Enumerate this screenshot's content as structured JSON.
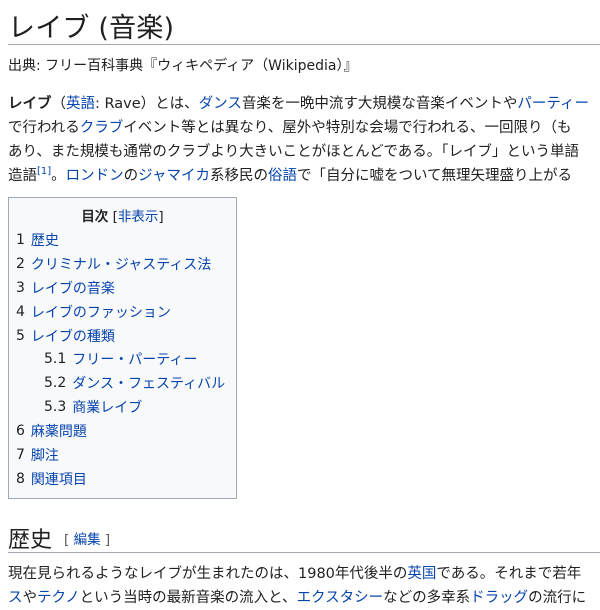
{
  "title": "レイブ (音楽)",
  "subtitle": "出典: フリー百科事典『ウィキペディア（Wikipedia）』",
  "intro": {
    "bold": "レイブ",
    "t1": "（",
    "link_english": "英語",
    "t2": ": Rave）とは、",
    "link_dance": "ダンス",
    "t3": "音楽を一晩中流す大規模な音楽イベントや",
    "link_party": "パーティー",
    "line2_a": "で行われる",
    "link_club": "クラブ",
    "line2_b": "イベント等とは異なり、屋外や特別な会場で行われる、一回限り（も",
    "line3": "あり、また規模も通常のクラブより大きいことがほとんどである。「レイブ」という単語",
    "line4_a": "造語",
    "ref1": "[1]",
    "line4_b": "。",
    "link_london": "ロンドン",
    "line4_c": "の",
    "link_jamaica": "ジャマイカ",
    "line4_d": "系移民の",
    "link_slang": "俗語",
    "line4_e": "で「自分に嘘をついて無理矢理盛り上がる"
  },
  "toc": {
    "title": "目次",
    "toggle_open": "[",
    "toggle_label": "非表示",
    "toggle_close": "]",
    "items": [
      {
        "num": "1",
        "label": "歴史"
      },
      {
        "num": "2",
        "label": "クリミナル・ジャスティス法"
      },
      {
        "num": "3",
        "label": "レイブの音楽"
      },
      {
        "num": "4",
        "label": "レイブのファッション"
      },
      {
        "num": "5",
        "label": "レイブの種類"
      },
      {
        "num": "5.1",
        "label": "フリー・パーティー"
      },
      {
        "num": "5.2",
        "label": "ダンス・フェスティバル"
      },
      {
        "num": "5.3",
        "label": "商業レイブ"
      },
      {
        "num": "6",
        "label": "麻薬問題"
      },
      {
        "num": "7",
        "label": "脚注"
      },
      {
        "num": "8",
        "label": "関連項目"
      }
    ]
  },
  "section": {
    "heading": "歴史",
    "edit_open": "[",
    "edit_label": "編集",
    "edit_close": "]",
    "line1_a": "現在見られるようなレイブが生まれたのは、1980年代後半の",
    "link_uk": "英国",
    "line1_b": "である。それまで若年",
    "line2_a": "ス",
    "line2_b": "や",
    "link_techno": "テクノ",
    "line2_c": "という当時の最新音楽の流入と、",
    "link_ecstasy": "エクスタシー",
    "line2_d": "などの多幸系",
    "link_drug": "ドラッグ",
    "line2_e": "の流行に"
  }
}
